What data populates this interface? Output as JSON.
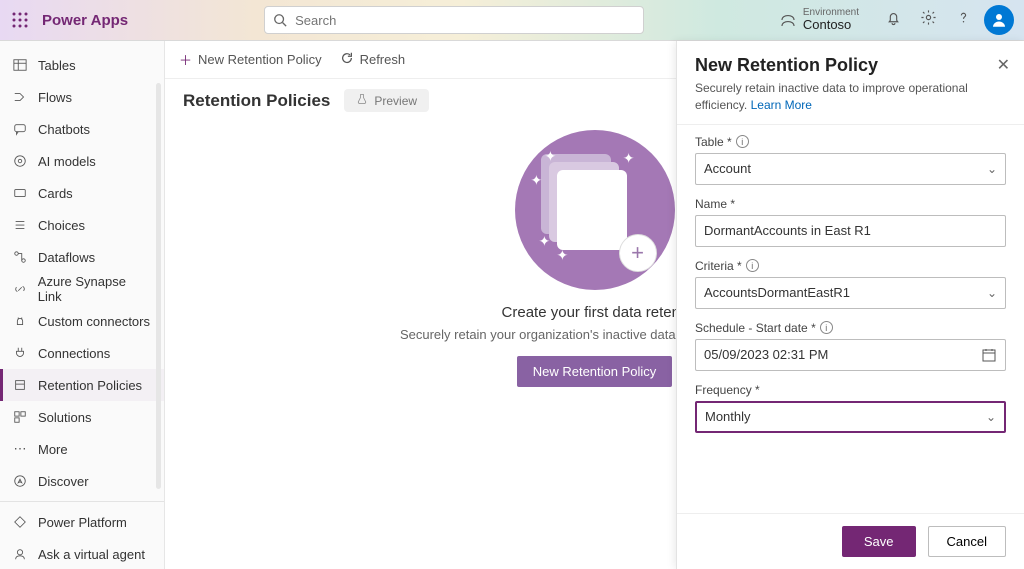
{
  "header": {
    "app_title": "Power Apps",
    "search_placeholder": "Search",
    "environment_label": "Environment",
    "environment_name": "Contoso"
  },
  "sidebar": {
    "items": [
      {
        "label": "Tables"
      },
      {
        "label": "Flows"
      },
      {
        "label": "Chatbots"
      },
      {
        "label": "AI models"
      },
      {
        "label": "Cards"
      },
      {
        "label": "Choices"
      },
      {
        "label": "Dataflows"
      },
      {
        "label": "Azure Synapse Link"
      },
      {
        "label": "Custom connectors"
      },
      {
        "label": "Connections"
      },
      {
        "label": "Retention Policies"
      },
      {
        "label": "Solutions"
      },
      {
        "label": "More"
      },
      {
        "label": "Discover"
      }
    ],
    "footer": [
      {
        "label": "Power Platform"
      },
      {
        "label": "Ask a virtual agent"
      }
    ]
  },
  "cmdbar": {
    "new_policy": "New Retention Policy",
    "refresh": "Refresh"
  },
  "page": {
    "title": "Retention Policies",
    "preview_badge": "Preview",
    "empty_title": "Create your first data retenti",
    "empty_sub": "Securely retain your organization's inactive data within Dataverse in",
    "empty_cta": "New Retention Policy"
  },
  "panel": {
    "title": "New Retention Policy",
    "subtitle": "Securely retain inactive data to improve operational efficiency.",
    "learn_more": "Learn More",
    "fields": {
      "table_label": "Table *",
      "table_value": "Account",
      "name_label": "Name *",
      "name_value": "DormantAccounts in East R1",
      "criteria_label": "Criteria *",
      "criteria_value": "AccountsDormantEastR1",
      "schedule_label": "Schedule - Start date *",
      "schedule_value": "05/09/2023 02:31 PM",
      "frequency_label": "Frequency *",
      "frequency_value": "Monthly"
    },
    "save": "Save",
    "cancel": "Cancel"
  }
}
